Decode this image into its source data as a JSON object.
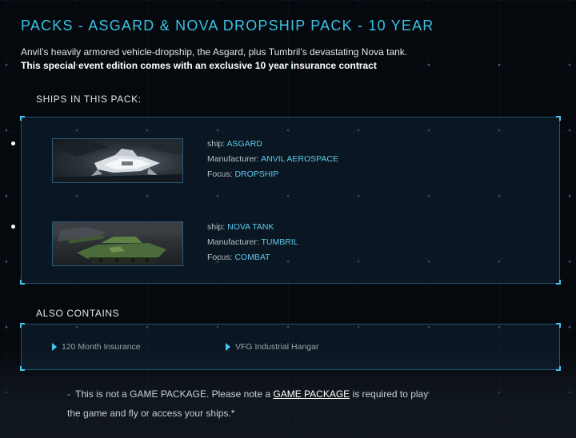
{
  "page": {
    "title": "PACKS - ASGARD & NOVA DROPSHIP PACK - 10 YEAR",
    "description_line1": "Anvil’s heavily armored vehicle-dropship, the Asgard, plus Tumbril’s devastating Nova tank.",
    "description_line2": "This special event edition comes with an exclusive 10 year insurance contract"
  },
  "ships_section": {
    "label": "SHIPS IN THIS PACK:",
    "ships": [
      {
        "ship_key": "ship:",
        "ship_value": "ASGARD",
        "manufacturer_key": "Manufacturer:",
        "manufacturer_value": "ANVIL AEROSPACE",
        "focus_key": "Focus:",
        "focus_value": "DROPSHIP",
        "image_icon": "asgard-ship-image"
      },
      {
        "ship_key": "ship:",
        "ship_value": "NOVA TANK",
        "manufacturer_key": "Manufacturer:",
        "manufacturer_value": "TUMBRIL",
        "focus_key": "Focus:",
        "focus_value": "COMBAT",
        "image_icon": "nova-tank-image"
      }
    ]
  },
  "also_contains": {
    "label": "ALSO CONTAINS",
    "items": [
      "120 Month Insurance",
      "VFG Industrial Hangar"
    ]
  },
  "note": {
    "dash": "-",
    "text_before": "This is not a GAME PACKAGE. Please note a",
    "link": "GAME PACKAGE",
    "text_after": "is required to play the game and fly or access your ships.*"
  },
  "colors": {
    "accent": "#39c2e6",
    "value": "#5fc9ee",
    "background": "#05080c"
  }
}
